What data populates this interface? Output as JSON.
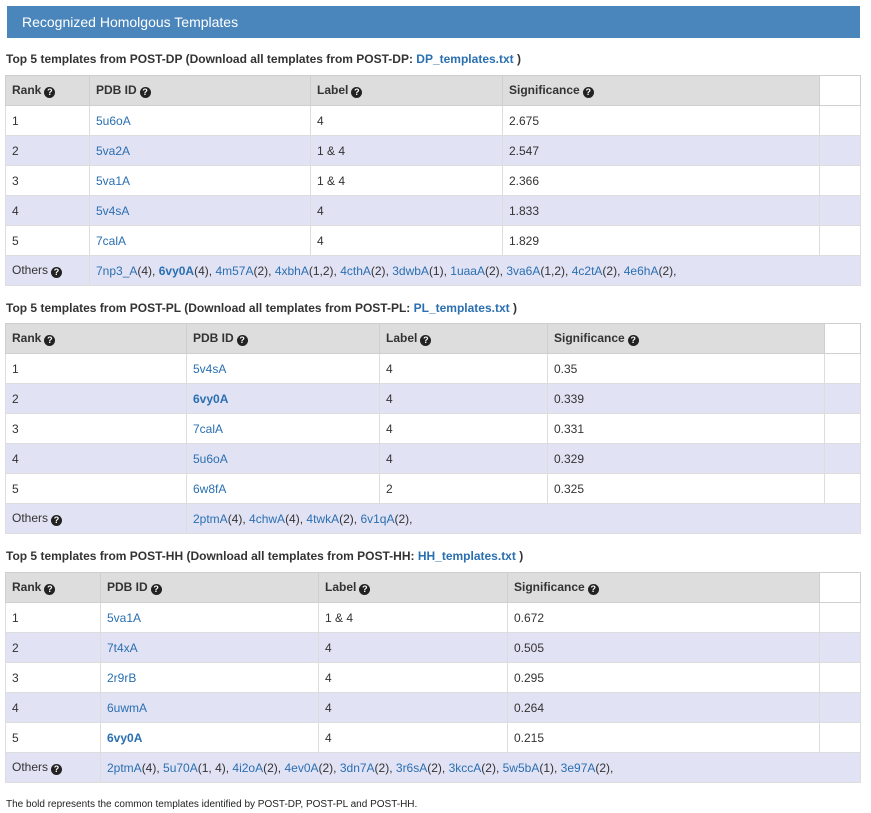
{
  "panel": {
    "title": "Recognized Homolgous Templates"
  },
  "columns": {
    "rank": "Rank",
    "pdb": "PDB ID",
    "label": "Label",
    "significance": "Significance",
    "others": "Others"
  },
  "sections": [
    {
      "title_prefix": "Top 5 templates from POST-DP (Download all templates from POST-DP: ",
      "link": "DP_templates.txt",
      "title_suffix": ")",
      "rows": [
        {
          "rank": "1",
          "pdb": "5u6oA",
          "bold": false,
          "label": "4",
          "sig": "2.675"
        },
        {
          "rank": "2",
          "pdb": "5va2A",
          "bold": false,
          "label": "1 & 4",
          "sig": "2.547"
        },
        {
          "rank": "3",
          "pdb": "5va1A",
          "bold": false,
          "label": "1 & 4",
          "sig": "2.366"
        },
        {
          "rank": "4",
          "pdb": "5v4sA",
          "bold": false,
          "label": "4",
          "sig": "1.833"
        },
        {
          "rank": "5",
          "pdb": "7calA",
          "bold": false,
          "label": "4",
          "sig": "1.829"
        }
      ],
      "others": [
        {
          "id": "7np3_A",
          "count": "(4)",
          "bold": false
        },
        {
          "id": "6vy0A",
          "count": "(4)",
          "bold": true
        },
        {
          "id": "4m57A",
          "count": "(2)",
          "bold": false
        },
        {
          "id": "4xbhA",
          "count": "(1,2)",
          "bold": false
        },
        {
          "id": "4cthA",
          "count": "(2)",
          "bold": false
        },
        {
          "id": "3dwbA",
          "count": "(1)",
          "bold": false
        },
        {
          "id": "1uaaA",
          "count": "(2)",
          "bold": false
        },
        {
          "id": "3va6A",
          "count": "(1,2)",
          "bold": false
        },
        {
          "id": "4c2tA",
          "count": "(2)",
          "bold": false
        },
        {
          "id": "4e6hA",
          "count": "(2)",
          "bold": false
        }
      ]
    },
    {
      "title_prefix": "Top 5 templates from POST-PL (Download all templates from POST-PL: ",
      "link": "PL_templates.txt",
      "title_suffix": ")",
      "rows": [
        {
          "rank": "1",
          "pdb": "5v4sA",
          "bold": false,
          "label": "4",
          "sig": "0.35"
        },
        {
          "rank": "2",
          "pdb": "6vy0A",
          "bold": true,
          "label": "4",
          "sig": "0.339"
        },
        {
          "rank": "3",
          "pdb": "7calA",
          "bold": false,
          "label": "4",
          "sig": "0.331"
        },
        {
          "rank": "4",
          "pdb": "5u6oA",
          "bold": false,
          "label": "4",
          "sig": "0.329"
        },
        {
          "rank": "5",
          "pdb": "6w8fA",
          "bold": false,
          "label": "2",
          "sig": "0.325"
        }
      ],
      "others": [
        {
          "id": "2ptmA",
          "count": "(4)",
          "bold": false
        },
        {
          "id": "4chwA",
          "count": "(4)",
          "bold": false
        },
        {
          "id": "4twkA",
          "count": "(2)",
          "bold": false
        },
        {
          "id": "6v1qA",
          "count": "(2)",
          "bold": false
        }
      ]
    },
    {
      "title_prefix": "Top 5 templates from POST-HH (Download all templates from POST-HH: ",
      "link": "HH_templates.txt",
      "title_suffix": ")",
      "rows": [
        {
          "rank": "1",
          "pdb": "5va1A",
          "bold": false,
          "label": "1 & 4",
          "sig": "0.672"
        },
        {
          "rank": "2",
          "pdb": "7t4xA",
          "bold": false,
          "label": "4",
          "sig": "0.505"
        },
        {
          "rank": "3",
          "pdb": "2r9rB",
          "bold": false,
          "label": "4",
          "sig": "0.295"
        },
        {
          "rank": "4",
          "pdb": "6uwmA",
          "bold": false,
          "label": "4",
          "sig": "0.264"
        },
        {
          "rank": "5",
          "pdb": "6vy0A",
          "bold": true,
          "label": "4",
          "sig": "0.215"
        }
      ],
      "others": [
        {
          "id": "2ptmA",
          "count": "(4)",
          "bold": false
        },
        {
          "id": "5u70A",
          "count": "(1, 4)",
          "bold": false
        },
        {
          "id": "4i2oA",
          "count": "(2)",
          "bold": false
        },
        {
          "id": "4ev0A",
          "count": "(2)",
          "bold": false
        },
        {
          "id": "3dn7A",
          "count": "(2)",
          "bold": false
        },
        {
          "id": "3r6sA",
          "count": "(2)",
          "bold": false
        },
        {
          "id": "3kccA",
          "count": "(2)",
          "bold": false
        },
        {
          "id": "5w5bA",
          "count": "(1)",
          "bold": false
        },
        {
          "id": "3e97A",
          "count": "(2)",
          "bold": false
        }
      ]
    }
  ],
  "footer": "The bold represents the common templates identified by POST-DP, POST-PL and POST-HH."
}
